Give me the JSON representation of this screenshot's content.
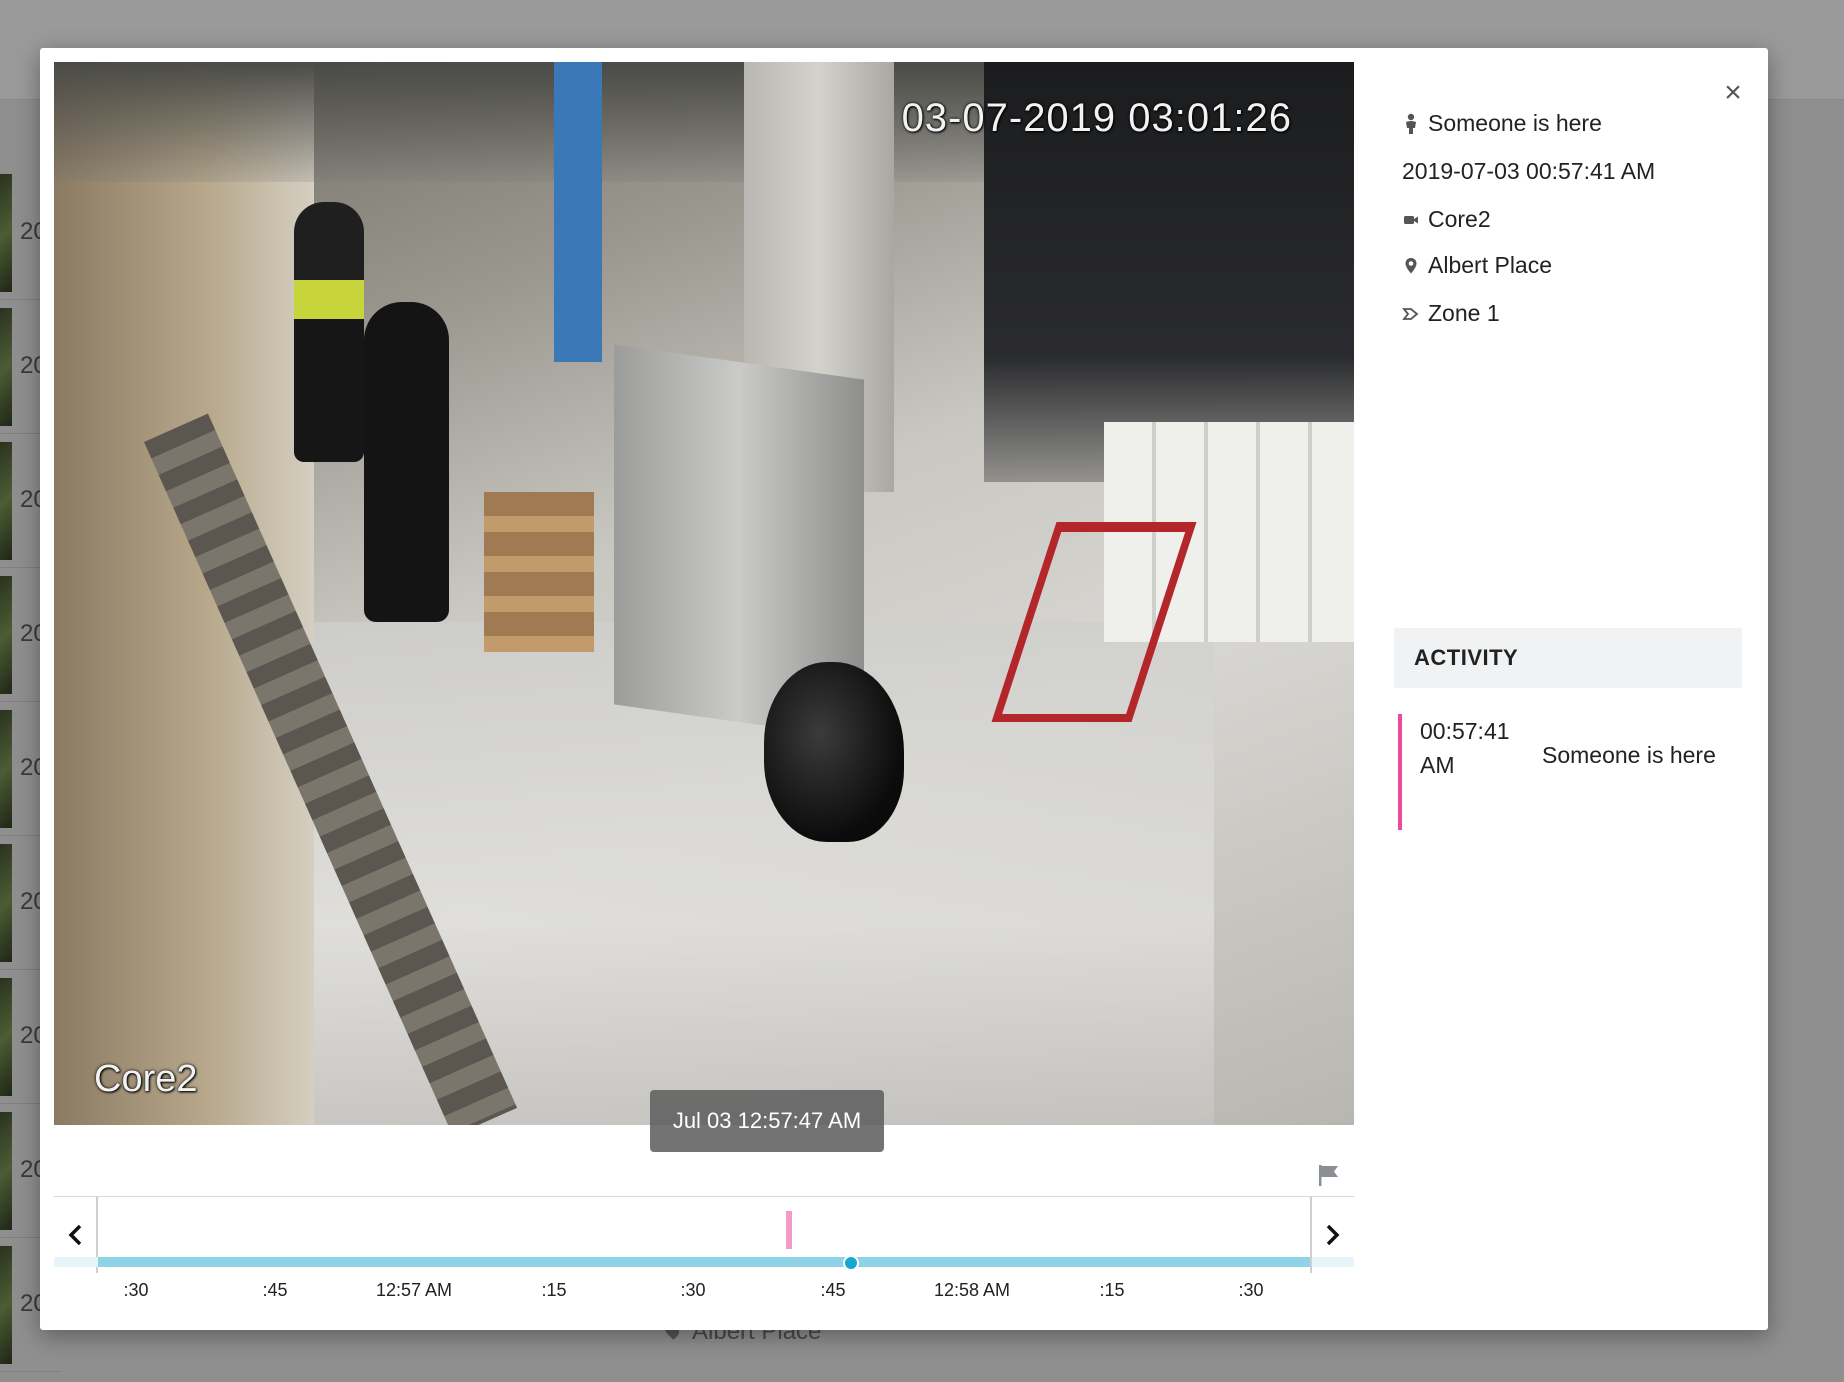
{
  "background": {
    "row_year_prefix": "20",
    "bottom_location": "Albert Place"
  },
  "video": {
    "overlay_timestamp": "03-07-2019 03:01:26",
    "overlay_camera": "Core2",
    "hover_tooltip": "Jul 03 12:57:47 AM"
  },
  "timeline": {
    "prev_icon": "chevron-left-icon",
    "next_icon": "chevron-right-icon",
    "flag_icon": "flag-icon",
    "tick_labels": [
      ":30",
      ":45",
      "12:57 AM",
      ":15",
      ":30",
      ":45",
      "12:58 AM",
      ":15",
      ":30"
    ],
    "bar_color": "#8fd3e6",
    "event_color": "#f39ac6",
    "cursor_color": "#19a7d2"
  },
  "event": {
    "title": "Someone is here",
    "datetime": "2019-07-03 00:57:41 AM",
    "camera": "Core2",
    "location": "Albert Place",
    "zone": "Zone 1"
  },
  "activity": {
    "header": "ACTIVITY",
    "items": [
      {
        "time": "00:57:41 AM",
        "label": "Someone is here",
        "accent": "#ec4b9a"
      }
    ]
  },
  "close_label": "×"
}
